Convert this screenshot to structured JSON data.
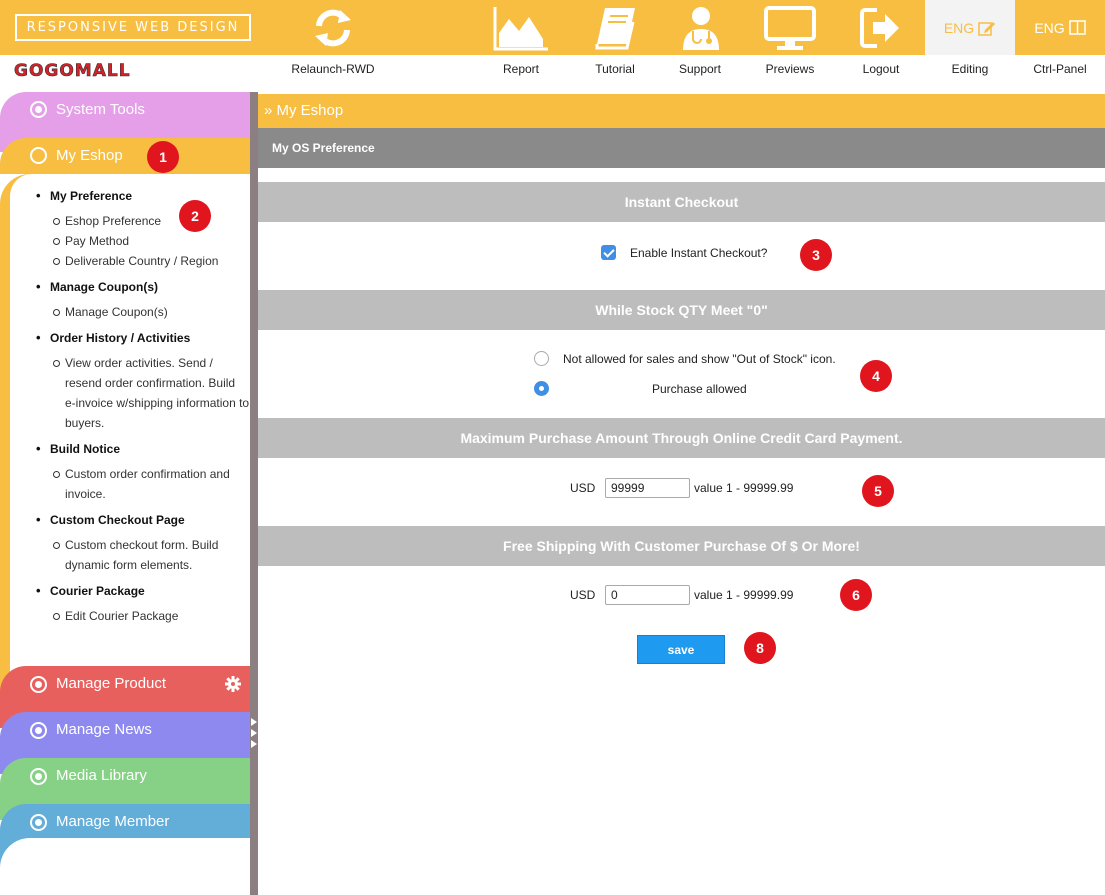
{
  "top_bar": {
    "rwd_label": "RESPONSIVE WEB DESIGN",
    "lang_editing": "ENG",
    "lang_panel": "ENG"
  },
  "brand": "GOGOMALL",
  "nav": [
    {
      "label": "Relaunch-RWD",
      "icon": "refresh-icon"
    },
    {
      "label": "Report",
      "icon": "area-chart-icon"
    },
    {
      "label": "Tutorial",
      "icon": "book-icon"
    },
    {
      "label": "Support",
      "icon": "doctor-icon"
    },
    {
      "label": "Previews",
      "icon": "monitor-icon"
    },
    {
      "label": "Logout",
      "icon": "logout-icon"
    },
    {
      "label": "Editing",
      "icon": "edit-icon"
    },
    {
      "label": "Ctrl-Panel",
      "icon": "panel-icon"
    }
  ],
  "sidebar": {
    "tabs": [
      {
        "label": "System Tools",
        "color": "#e59ee8"
      },
      {
        "label": "My Eshop",
        "color": "#f7be42"
      },
      {
        "label": "Manage Product",
        "color": "#e8605e"
      },
      {
        "label": "Manage News",
        "color": "#8d89ee"
      },
      {
        "label": "Media Library",
        "color": "#87d186"
      },
      {
        "label": "Manage Member",
        "color": "#63add9"
      }
    ],
    "menu": [
      {
        "title": "My Preference",
        "items": [
          "Eshop Preference",
          "Pay Method",
          "Deliverable Country / Region"
        ]
      },
      {
        "title": "Manage Coupon(s)",
        "items": [
          "Manage Coupon(s)"
        ]
      },
      {
        "title": "Order History / Activities",
        "items": [
          "View order activities. Send /",
          "resend order confirmation. Build",
          "e-invoice w/shipping information to",
          "buyers."
        ]
      },
      {
        "title": "Build Notice",
        "items": [
          "Custom order confirmation and",
          "invoice."
        ]
      },
      {
        "title": "Custom Checkout Page",
        "items": [
          "Custom checkout form. Build",
          "dynamic form elements."
        ]
      },
      {
        "title": "Courier Package",
        "items": [
          "Edit Courier Package"
        ]
      }
    ]
  },
  "main": {
    "header": "» My Eshop",
    "subheader": "My OS Preference",
    "instant_checkout": {
      "title": "Instant Checkout",
      "checkbox_label": "Enable Instant Checkout?",
      "checked": true
    },
    "stock_zero": {
      "title": "While Stock QTY Meet \"0\"",
      "options": [
        "Not allowed for sales and show \"Out of Stock\" icon.",
        "Purchase allowed"
      ],
      "selected_index": 1
    },
    "max_purchase": {
      "title": "Maximum Purchase Amount Through Online Credit Card Payment.",
      "currency": "USD",
      "value": "99999",
      "hint": "value 1 - 99999.99"
    },
    "free_shipping": {
      "title": "Free Shipping With Customer Purchase Of $ Or More!",
      "currency": "USD",
      "value": "0",
      "hint": "value 1 - 99999.99"
    },
    "save_label": "save"
  },
  "badges": [
    "1",
    "2",
    "3",
    "4",
    "5",
    "6",
    "8"
  ],
  "colors": {
    "accent": "#f7be42",
    "section_bar": "#bdbdbd",
    "subheader": "#8a8a8a",
    "badge": "#e1151d",
    "save_button": "#1e9af0"
  }
}
